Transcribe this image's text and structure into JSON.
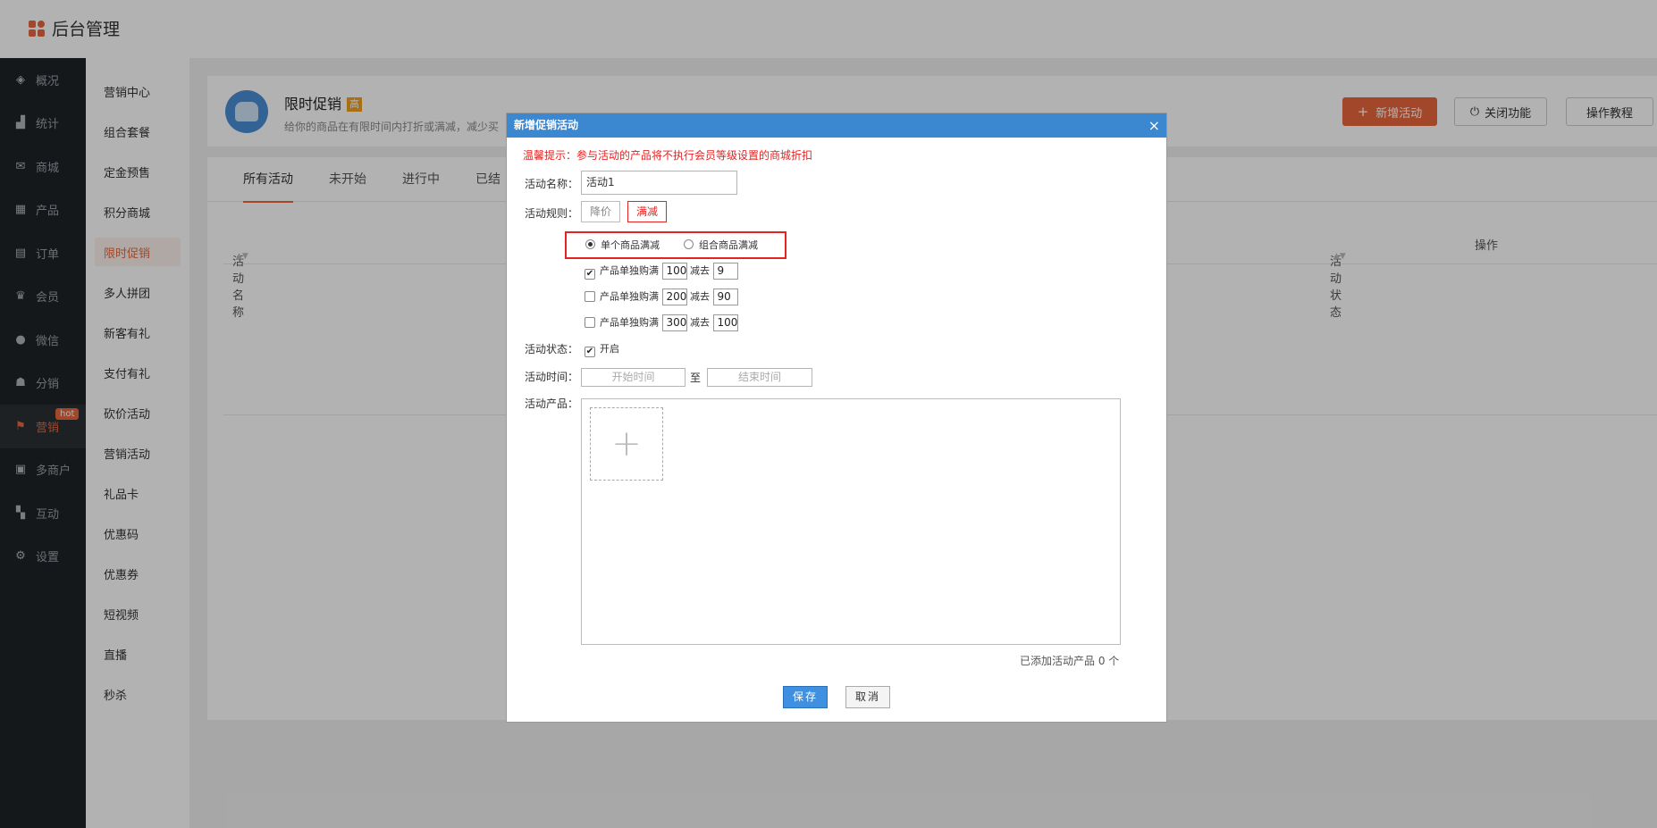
{
  "app": {
    "title": "后台管理"
  },
  "sidebar": {
    "hot_badge": "hot",
    "items": [
      {
        "label": "概况",
        "icon": "layers-icon"
      },
      {
        "label": "统计",
        "icon": "chart-icon"
      },
      {
        "label": "商城",
        "icon": "mail-icon"
      },
      {
        "label": "产品",
        "icon": "apps-icon"
      },
      {
        "label": "订单",
        "icon": "order-icon"
      },
      {
        "label": "会员",
        "icon": "crown-icon"
      },
      {
        "label": "微信",
        "icon": "wechat-icon"
      },
      {
        "label": "分销",
        "icon": "users-icon"
      },
      {
        "label": "营销",
        "icon": "flag-icon"
      },
      {
        "label": "多商户",
        "icon": "store-icon"
      },
      {
        "label": "互动",
        "icon": "interact-icon"
      },
      {
        "label": "设置",
        "icon": "gear-icon"
      }
    ]
  },
  "subnav": {
    "items": [
      "营销中心",
      "组合套餐",
      "定金预售",
      "积分商城",
      "限时促销",
      "多人拼团",
      "新客有礼",
      "支付有礼",
      "砍价活动",
      "营销活动",
      "礼品卡",
      "优惠码",
      "优惠券",
      "短视频",
      "直播",
      "秒杀"
    ]
  },
  "header": {
    "title": "限时促销",
    "badge": "高",
    "desc": "给你的商品在有限时间内打折或满减，减少买",
    "new_button": "新增活动",
    "close_button": "关闭功能",
    "tutorial_button": "操作教程"
  },
  "tabs": [
    "所有活动",
    "未开始",
    "进行中",
    "已结"
  ],
  "table": {
    "col_name": "活动名称",
    "col_status": "活动状态",
    "col_ops": "操作"
  },
  "modal": {
    "title": "新增促销活动",
    "close": "×",
    "warning": "温馨提示：参与活动的产品将不执行会员等级设置的商城折扣",
    "name_label": "活动名称：",
    "name_value": "活动1",
    "rule_label": "活动规则：",
    "rule_discount": "降价",
    "rule_fullcut": "满减",
    "radio_single": "单个商品满减",
    "radio_combo": "组合商品满减",
    "tiers": [
      {
        "checked": true,
        "prefix": "产品单独购满",
        "amount": "100",
        "minus_label": "减去",
        "minus": "9"
      },
      {
        "checked": false,
        "prefix": "产品单独购满",
        "amount": "200",
        "minus_label": "减去",
        "minus": "90"
      },
      {
        "checked": false,
        "prefix": "产品单独购满",
        "amount": "300",
        "minus_label": "减去",
        "minus": "100"
      }
    ],
    "status_label": "活动状态：",
    "status_value": "开启",
    "time_label": "活动时间：",
    "start_placeholder": "开始时间",
    "to": "至",
    "end_placeholder": "结束时间",
    "product_label": "活动产品：",
    "added_count": "已添加活动产品 0 个",
    "save": "保存",
    "cancel": "取消"
  },
  "colors": {
    "accent": "#e8663d",
    "modal_header": "#3b87d0",
    "warning": "#e62222"
  }
}
